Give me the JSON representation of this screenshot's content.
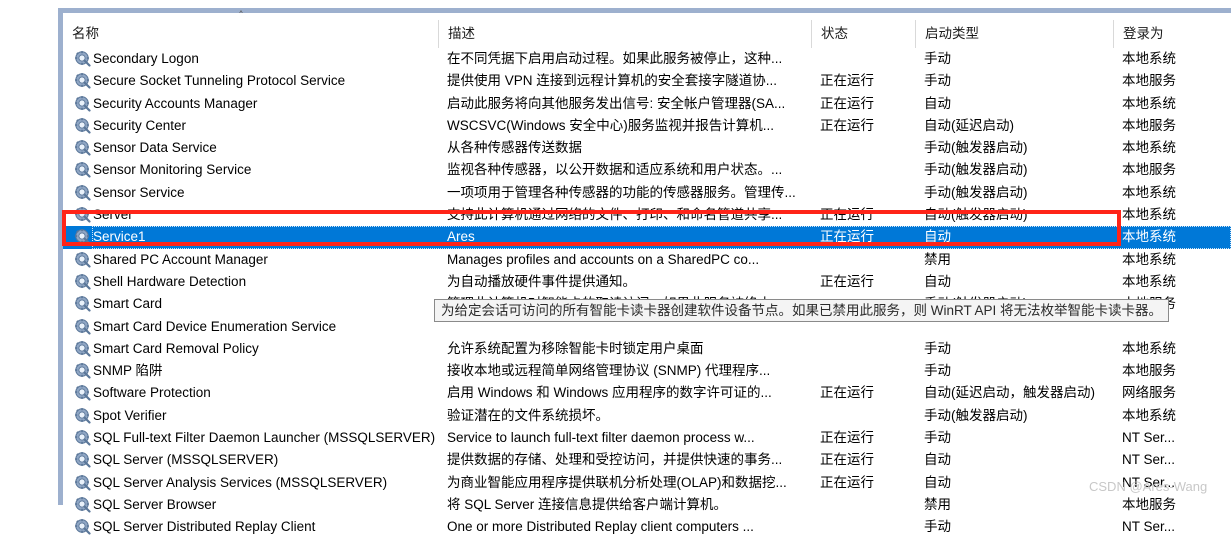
{
  "panel": {
    "sort_caret": "˄"
  },
  "columns": [
    {
      "key": "name",
      "label": "名称"
    },
    {
      "key": "desc",
      "label": "描述"
    },
    {
      "key": "status",
      "label": "状态"
    },
    {
      "key": "start",
      "label": "启动类型"
    },
    {
      "key": "logon",
      "label": "登录为"
    }
  ],
  "rows": [
    {
      "name": "Secondary Logon",
      "desc": "在不同凭据下启用启动过程。如果此服务被停止，这种...",
      "status": "",
      "start": "手动",
      "logon": "本地系统",
      "selected": false
    },
    {
      "name": "Secure Socket Tunneling Protocol Service",
      "desc": "提供使用 VPN 连接到远程计算机的安全套接字隧道协...",
      "status": "正在运行",
      "start": "手动",
      "logon": "本地服务",
      "selected": false
    },
    {
      "name": "Security Accounts Manager",
      "desc": "启动此服务将向其他服务发出信号: 安全帐户管理器(SA...",
      "status": "正在运行",
      "start": "自动",
      "logon": "本地系统",
      "selected": false
    },
    {
      "name": "Security Center",
      "desc": "WSCSVC(Windows 安全中心)服务监视并报告计算机...",
      "status": "正在运行",
      "start": "自动(延迟启动)",
      "logon": "本地服务",
      "selected": false
    },
    {
      "name": "Sensor Data Service",
      "desc": "从各种传感器传送数据",
      "status": "",
      "start": "手动(触发器启动)",
      "logon": "本地系统",
      "selected": false
    },
    {
      "name": "Sensor Monitoring Service",
      "desc": "监视各种传感器，以公开数据和适应系统和用户状态。...",
      "status": "",
      "start": "手动(触发器启动)",
      "logon": "本地服务",
      "selected": false
    },
    {
      "name": "Sensor Service",
      "desc": "一项项用于管理各种传感器的功能的传感器服务。管理传...",
      "status": "",
      "start": "手动(触发器启动)",
      "logon": "本地系统",
      "selected": false
    },
    {
      "name": "Server",
      "desc": "支持此计算机通过网络的文件、打印、和命名管道共享...",
      "status": "正在运行",
      "start": "自动(触发器启动)",
      "logon": "本地系统",
      "selected": false
    },
    {
      "name": "Service1",
      "desc": "Ares",
      "status": "正在运行",
      "start": "自动",
      "logon": "本地系统",
      "selected": true
    },
    {
      "name": "Shared PC Account Manager",
      "desc": "Manages profiles and accounts on a SharedPC co...",
      "status": "",
      "start": "禁用",
      "logon": "本地系统",
      "selected": false
    },
    {
      "name": "Shell Hardware Detection",
      "desc": "为自动播放硬件事件提供通知。",
      "status": "正在运行",
      "start": "自动",
      "logon": "本地系统",
      "selected": false
    },
    {
      "name": "Smart Card",
      "desc": "管理此计算机对智能卡的取读访问。如果此服务被终止...",
      "status": "",
      "start": "手动(触发器启动)",
      "logon": "本地服务",
      "selected": false
    },
    {
      "name": "Smart Card Device Enumeration Service",
      "desc": "",
      "status": "",
      "start": "",
      "logon": "",
      "selected": false
    },
    {
      "name": "Smart Card Removal Policy",
      "desc": "允许系统配置为移除智能卡时锁定用户桌面",
      "status": "",
      "start": "手动",
      "logon": "本地系统",
      "selected": false
    },
    {
      "name": "SNMP 陷阱",
      "desc": "接收本地或远程简单网络管理协议 (SNMP) 代理程序...",
      "status": "",
      "start": "手动",
      "logon": "本地服务",
      "selected": false
    },
    {
      "name": "Software Protection",
      "desc": "启用 Windows 和 Windows 应用程序的数字许可证的...",
      "status": "正在运行",
      "start": "自动(延迟启动，触发器启动)",
      "logon": "网络服务",
      "selected": false
    },
    {
      "name": "Spot Verifier",
      "desc": "验证潜在的文件系统损坏。",
      "status": "",
      "start": "手动(触发器启动)",
      "logon": "本地系统",
      "selected": false
    },
    {
      "name": "SQL Full-text Filter Daemon Launcher (MSSQLSERVER)",
      "desc": "Service to launch full-text filter daemon process w...",
      "status": "正在运行",
      "start": "手动",
      "logon": "NT Ser...",
      "selected": false
    },
    {
      "name": "SQL Server (MSSQLSERVER)",
      "desc": "提供数据的存储、处理和受控访问，并提供快速的事务...",
      "status": "正在运行",
      "start": "自动",
      "logon": "NT Ser...",
      "selected": false
    },
    {
      "name": "SQL Server Analysis Services (MSSQLSERVER)",
      "desc": "为商业智能应用程序提供联机分析处理(OLAP)和数据挖...",
      "status": "正在运行",
      "start": "自动",
      "logon": "NT Ser...",
      "selected": false
    },
    {
      "name": "SQL Server Browser",
      "desc": "将 SQL Server 连接信息提供给客户端计算机。",
      "status": "",
      "start": "禁用",
      "logon": "本地服务",
      "selected": false
    },
    {
      "name": "SQL Server Distributed Replay Client",
      "desc": "One or more Distributed Replay client computers ...",
      "status": "",
      "start": "手动",
      "logon": "NT Ser...",
      "selected": false
    }
  ],
  "tooltip": {
    "text": "为给定会话可访问的所有智能卡读卡器创建软件设备节点。如果已禁用此服务，则 WinRT API 将无法枚举智能卡读卡器。"
  },
  "watermark": {
    "text": "CSDN @Ares-Wang"
  },
  "colors": {
    "selection": "#0078d7",
    "annotation": "#ff2418",
    "panel_frame": "#9db0ce",
    "tooltip_bg": "#f4f4f4"
  }
}
